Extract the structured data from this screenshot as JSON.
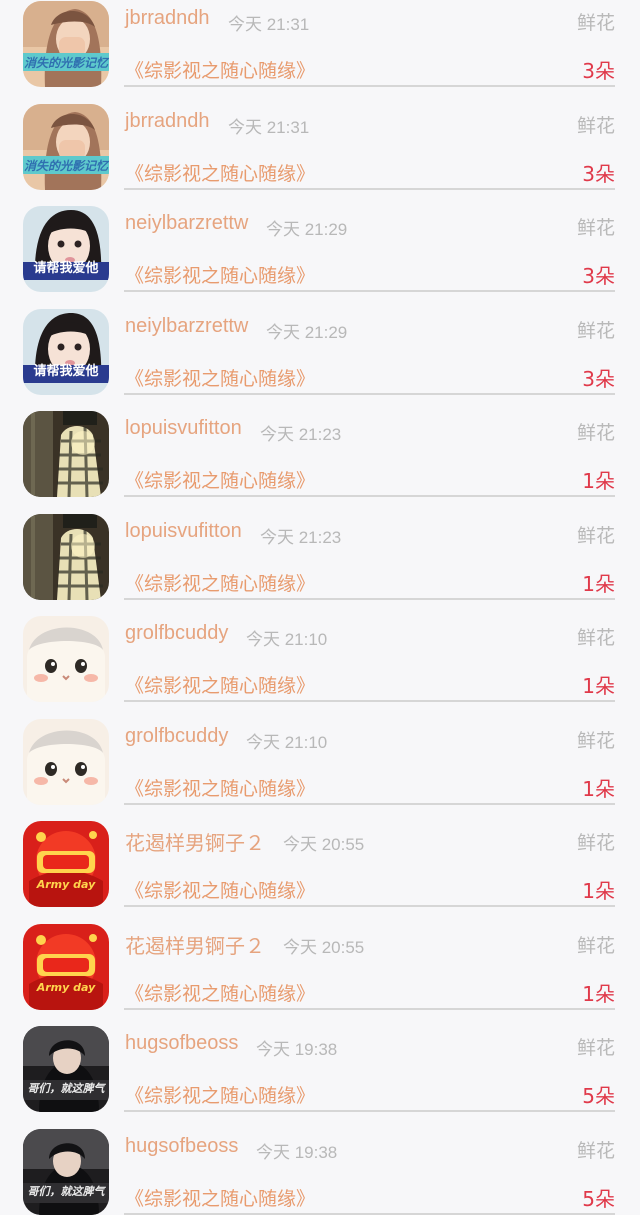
{
  "colors": {
    "username": "#e6a47f",
    "time": "#b8b8b8",
    "gift_label": "#b9b9b9",
    "book": "#e89b6e",
    "count": "#e0394a"
  },
  "records": [
    {
      "username": "jbrradndh",
      "time": "今天 21:31",
      "gift_label": "鲜花",
      "book": "《综影视之随心随缘》",
      "count": "3朵",
      "avatar": {
        "icon": "photo-girl-hand",
        "caption": "消失的光影记忆"
      }
    },
    {
      "username": "jbrradndh",
      "time": "今天 21:31",
      "gift_label": "鲜花",
      "book": "《综影视之随心随缘》",
      "count": "3朵",
      "avatar": {
        "icon": "photo-girl-hand",
        "caption": "消失的光影记忆"
      }
    },
    {
      "username": "neiylbarzrettw",
      "time": "今天 21:29",
      "gift_label": "鲜花",
      "book": "《综影视之随心随缘》",
      "count": "3朵",
      "avatar": {
        "icon": "photo-girl-face",
        "caption": "请帮我爱他"
      }
    },
    {
      "username": "neiylbarzrettw",
      "time": "今天 21:29",
      "gift_label": "鲜花",
      "book": "《综影视之随心随缘》",
      "count": "3朵",
      "avatar": {
        "icon": "photo-girl-face",
        "caption": "请帮我爱他"
      }
    },
    {
      "username": "lopuisvufitton",
      "time": "今天 21:23",
      "gift_label": "鲜花",
      "book": "《综影视之随心随缘》",
      "count": "1朵",
      "avatar": {
        "icon": "photo-plaid-shirt"
      }
    },
    {
      "username": "lopuisvufitton",
      "time": "今天 21:23",
      "gift_label": "鲜花",
      "book": "《综影视之随心随缘》",
      "count": "1朵",
      "avatar": {
        "icon": "photo-plaid-shirt"
      }
    },
    {
      "username": "grolfbcuddy",
      "time": "今天 21:10",
      "gift_label": "鲜花",
      "book": "《综影视之随心随缘》",
      "count": "1朵",
      "avatar": {
        "icon": "illustration-white-cat"
      }
    },
    {
      "username": "grolfbcuddy",
      "time": "今天 21:10",
      "gift_label": "鲜花",
      "book": "《综影视之随心随缘》",
      "count": "1朵",
      "avatar": {
        "icon": "illustration-white-cat"
      }
    },
    {
      "username": "花遏样男锕子２",
      "time": "今天 20:55",
      "gift_label": "鲜花",
      "book": "《综影视之随心随缘》",
      "count": "1朵",
      "avatar": {
        "icon": "festival-red-badge",
        "caption": "Army day"
      }
    },
    {
      "username": "花遏样男锕子２",
      "time": "今天 20:55",
      "gift_label": "鲜花",
      "book": "《综影视之随心随缘》",
      "count": "1朵",
      "avatar": {
        "icon": "festival-red-badge",
        "caption": "Army day"
      }
    },
    {
      "username": "hugsofbeoss",
      "time": "今天 19:38",
      "gift_label": "鲜花",
      "book": "《综影视之随心随缘》",
      "count": "5朵",
      "avatar": {
        "icon": "photo-boy-dark",
        "caption": "哥们，就这脾气"
      }
    },
    {
      "username": "hugsofbeoss",
      "time": "今天 19:38",
      "gift_label": "鲜花",
      "book": "《综影视之随心随缘》",
      "count": "5朵",
      "avatar": {
        "icon": "photo-boy-dark",
        "caption": "哥们，就这脾气"
      }
    }
  ]
}
